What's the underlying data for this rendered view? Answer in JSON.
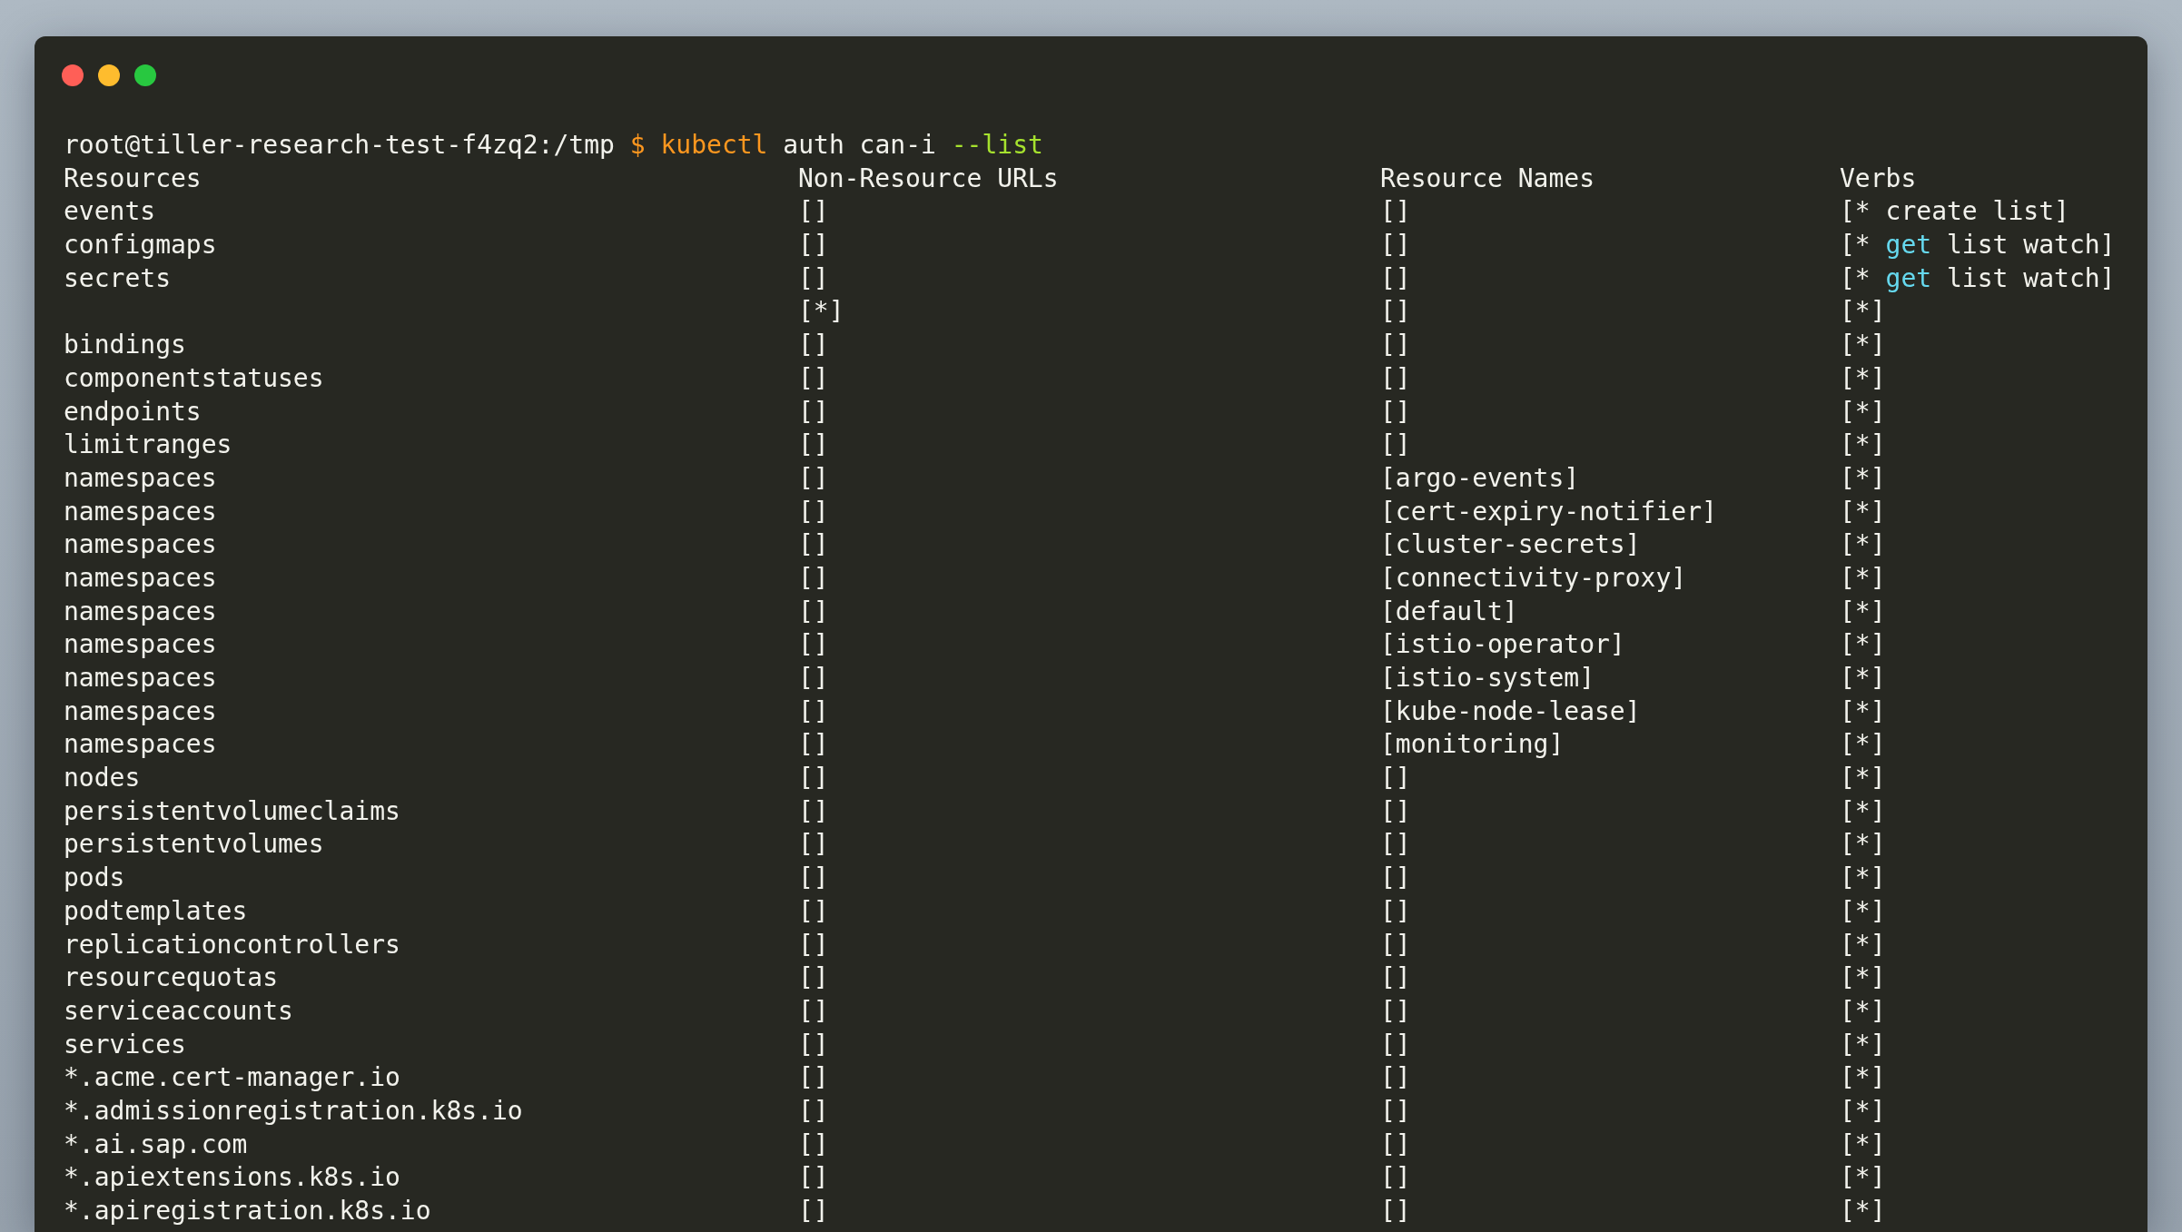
{
  "window_controls": [
    {
      "color": "#ff5f57"
    },
    {
      "color": "#febc2e"
    },
    {
      "color": "#28c840"
    }
  ],
  "command_line": {
    "segments": [
      {
        "kind": "prompt",
        "text": "root@tiller-research-test-f4zq2:/tmp"
      },
      {
        "kind": "symbol",
        "text": "$"
      },
      {
        "kind": "command",
        "text": "kubectl"
      },
      {
        "kind": "plain",
        "text": "auth can-i"
      },
      {
        "kind": "flag",
        "text": "--list"
      }
    ]
  },
  "table": {
    "columns": [
      "Resources",
      "Non-Resource URLs",
      "Resource Names",
      "Verbs"
    ],
    "rows": [
      {
        "resource": "events",
        "non_resource_urls": "[]",
        "resource_names": "[]",
        "verbs": [
          {
            "kind": "plain",
            "text": "[* create list]"
          }
        ]
      },
      {
        "resource": "configmaps",
        "non_resource_urls": "[]",
        "resource_names": "[]",
        "verbs": [
          {
            "kind": "plain",
            "text": "[*"
          },
          {
            "kind": "keyword",
            "text": "get"
          },
          {
            "kind": "plain",
            "text": "list watch]"
          }
        ]
      },
      {
        "resource": "secrets",
        "non_resource_urls": "[]",
        "resource_names": "[]",
        "verbs": [
          {
            "kind": "plain",
            "text": "[*"
          },
          {
            "kind": "keyword",
            "text": "get"
          },
          {
            "kind": "plain",
            "text": "list watch]"
          }
        ]
      },
      {
        "non_resource_urls": "[*]",
        "resource_names": "[]",
        "verbs": [
          {
            "kind": "plain",
            "text": "[*]"
          }
        ]
      },
      {
        "resource": "bindings",
        "non_resource_urls": "[]",
        "resource_names": "[]",
        "verbs": [
          {
            "kind": "plain",
            "text": "[*]"
          }
        ]
      },
      {
        "resource": "componentstatuses",
        "non_resource_urls": "[]",
        "resource_names": "[]",
        "verbs": [
          {
            "kind": "plain",
            "text": "[*]"
          }
        ]
      },
      {
        "resource": "endpoints",
        "non_resource_urls": "[]",
        "resource_names": "[]",
        "verbs": [
          {
            "kind": "plain",
            "text": "[*]"
          }
        ]
      },
      {
        "resource": "limitranges",
        "non_resource_urls": "[]",
        "resource_names": "[]",
        "verbs": [
          {
            "kind": "plain",
            "text": "[*]"
          }
        ]
      },
      {
        "resource": "namespaces",
        "non_resource_urls": "[]",
        "resource_names": "[argo-events]",
        "verbs": [
          {
            "kind": "plain",
            "text": "[*]"
          }
        ]
      },
      {
        "resource": "namespaces",
        "non_resource_urls": "[]",
        "resource_names": "[cert-expiry-notifier]",
        "verbs": [
          {
            "kind": "plain",
            "text": "[*]"
          }
        ]
      },
      {
        "resource": "namespaces",
        "non_resource_urls": "[]",
        "resource_names": "[cluster-secrets]",
        "verbs": [
          {
            "kind": "plain",
            "text": "[*]"
          }
        ]
      },
      {
        "resource": "namespaces",
        "non_resource_urls": "[]",
        "resource_names": "[connectivity-proxy]",
        "verbs": [
          {
            "kind": "plain",
            "text": "[*]"
          }
        ]
      },
      {
        "resource": "namespaces",
        "non_resource_urls": "[]",
        "resource_names": "[default]",
        "verbs": [
          {
            "kind": "plain",
            "text": "[*]"
          }
        ]
      },
      {
        "resource": "namespaces",
        "non_resource_urls": "[]",
        "resource_names": "[istio-operator]",
        "verbs": [
          {
            "kind": "plain",
            "text": "[*]"
          }
        ]
      },
      {
        "resource": "namespaces",
        "non_resource_urls": "[]",
        "resource_names": "[istio-system]",
        "verbs": [
          {
            "kind": "plain",
            "text": "[*]"
          }
        ]
      },
      {
        "resource": "namespaces",
        "non_resource_urls": "[]",
        "resource_names": "[kube-node-lease]",
        "verbs": [
          {
            "kind": "plain",
            "text": "[*]"
          }
        ]
      },
      {
        "resource": "namespaces",
        "non_resource_urls": "[]",
        "resource_names": "[monitoring]",
        "verbs": [
          {
            "kind": "plain",
            "text": "[*]"
          }
        ]
      },
      {
        "resource": "nodes",
        "non_resource_urls": "[]",
        "resource_names": "[]",
        "verbs": [
          {
            "kind": "plain",
            "text": "[*]"
          }
        ]
      },
      {
        "resource": "persistentvolumeclaims",
        "non_resource_urls": "[]",
        "resource_names": "[]",
        "verbs": [
          {
            "kind": "plain",
            "text": "[*]"
          }
        ]
      },
      {
        "resource": "persistentvolumes",
        "non_resource_urls": "[]",
        "resource_names": "[]",
        "verbs": [
          {
            "kind": "plain",
            "text": "[*]"
          }
        ]
      },
      {
        "resource": "pods",
        "non_resource_urls": "[]",
        "resource_names": "[]",
        "verbs": [
          {
            "kind": "plain",
            "text": "[*]"
          }
        ]
      },
      {
        "resource": "podtemplates",
        "non_resource_urls": "[]",
        "resource_names": "[]",
        "verbs": [
          {
            "kind": "plain",
            "text": "[*]"
          }
        ]
      },
      {
        "resource": "replicationcontrollers",
        "non_resource_urls": "[]",
        "resource_names": "[]",
        "verbs": [
          {
            "kind": "plain",
            "text": "[*]"
          }
        ]
      },
      {
        "resource": "resourcequotas",
        "non_resource_urls": "[]",
        "resource_names": "[]",
        "verbs": [
          {
            "kind": "plain",
            "text": "[*]"
          }
        ]
      },
      {
        "resource": "serviceaccounts",
        "non_resource_urls": "[]",
        "resource_names": "[]",
        "verbs": [
          {
            "kind": "plain",
            "text": "[*]"
          }
        ]
      },
      {
        "resource": "services",
        "non_resource_urls": "[]",
        "resource_names": "[]",
        "verbs": [
          {
            "kind": "plain",
            "text": "[*]"
          }
        ]
      },
      {
        "resource": "*.acme.cert-manager.io",
        "non_resource_urls": "[]",
        "resource_names": "[]",
        "verbs": [
          {
            "kind": "plain",
            "text": "[*]"
          }
        ]
      },
      {
        "resource": "*.admissionregistration.k8s.io",
        "non_resource_urls": "[]",
        "resource_names": "[]",
        "verbs": [
          {
            "kind": "plain",
            "text": "[*]"
          }
        ]
      },
      {
        "resource": "*.ai.sap.com",
        "non_resource_urls": "[]",
        "resource_names": "[]",
        "verbs": [
          {
            "kind": "plain",
            "text": "[*]"
          }
        ]
      },
      {
        "resource": "*.apiextensions.k8s.io",
        "non_resource_urls": "[]",
        "resource_names": "[]",
        "verbs": [
          {
            "kind": "plain",
            "text": "[*]"
          }
        ]
      },
      {
        "resource": "*.apiregistration.k8s.io",
        "non_resource_urls": "[]",
        "resource_names": "[]",
        "verbs": [
          {
            "kind": "plain",
            "text": "[*]"
          }
        ]
      }
    ]
  }
}
